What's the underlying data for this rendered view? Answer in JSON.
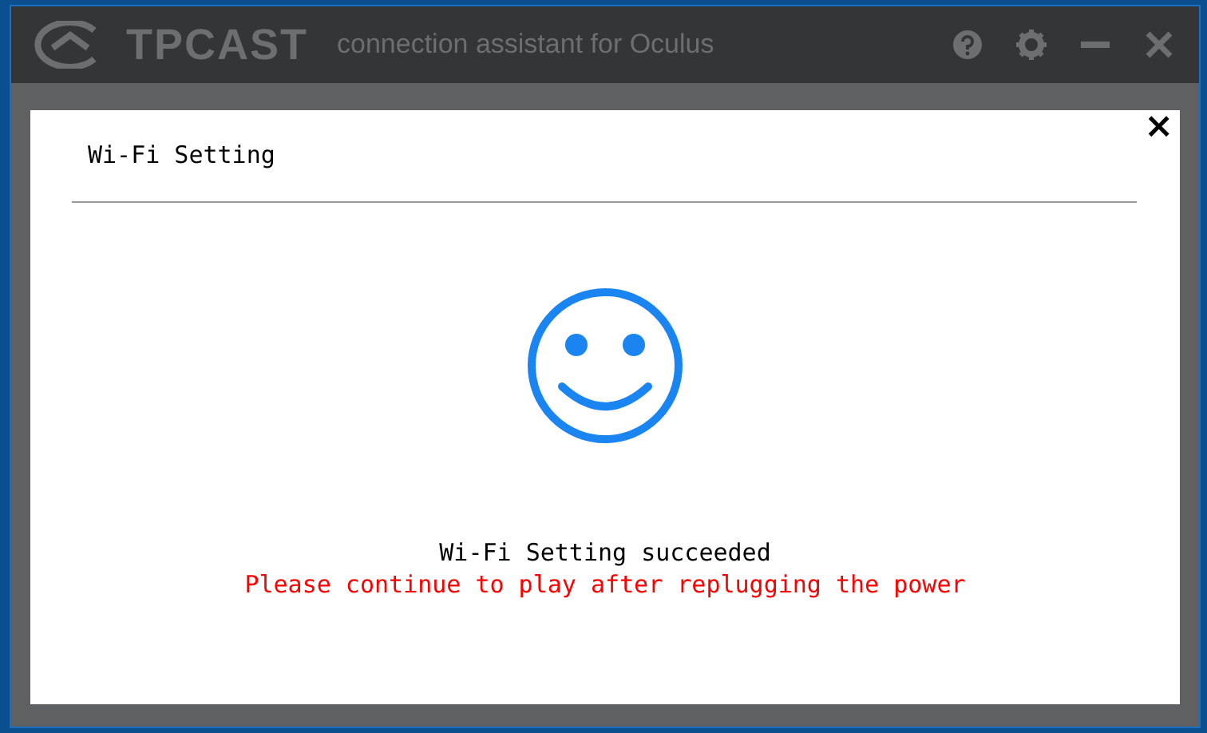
{
  "window": {
    "logo": "TPCAST",
    "title": "connection assistant for Oculus"
  },
  "dialog": {
    "title": "Wi-Fi Setting",
    "close": "×",
    "message": "Wi-Fi Setting succeeded",
    "instruction": "Please continue to play after replugging the power"
  }
}
